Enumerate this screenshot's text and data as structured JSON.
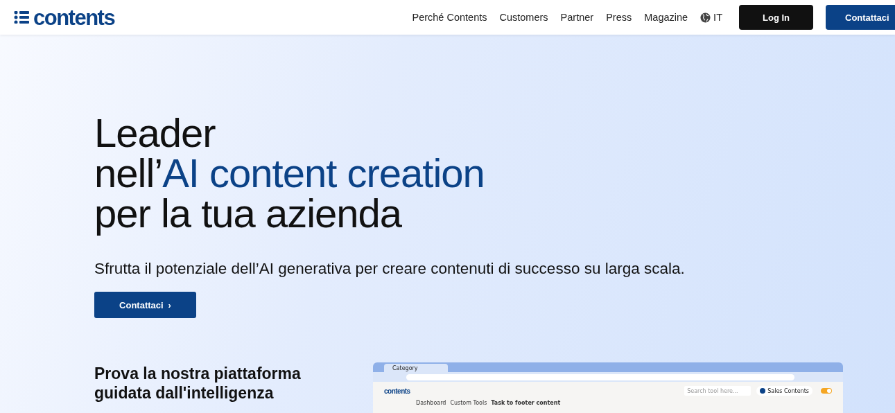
{
  "header": {
    "logo": "contents",
    "nav": [
      {
        "label": "Perché Contents"
      },
      {
        "label": "Customers"
      },
      {
        "label": "Partner"
      },
      {
        "label": "Press"
      },
      {
        "label": "Magazine"
      }
    ],
    "language": "IT",
    "login": "Log In",
    "contact": "Contattaci"
  },
  "hero": {
    "title_lines": [
      "Leader",
      "nell’**AI content creation**",
      "per la tua azienda"
    ],
    "subtitle": "Sfrutta il potenziale dell’AI generativa per creare contenuti di successo su larga scala.",
    "cta": "Contattaci",
    "cta_icon": "›"
  },
  "platform": {
    "heading": "Prova la nostra piattaforma guidata dall'intelligenza"
  },
  "mockup": {
    "tab_title": "Category",
    "app_logo": "contents",
    "search_placeholder": "Search tool here...",
    "user": "Sales Contents",
    "toggle_on": true,
    "breadcrumb": [
      "Dashboard",
      "Custom Tools",
      "Task to footer content"
    ]
  }
}
